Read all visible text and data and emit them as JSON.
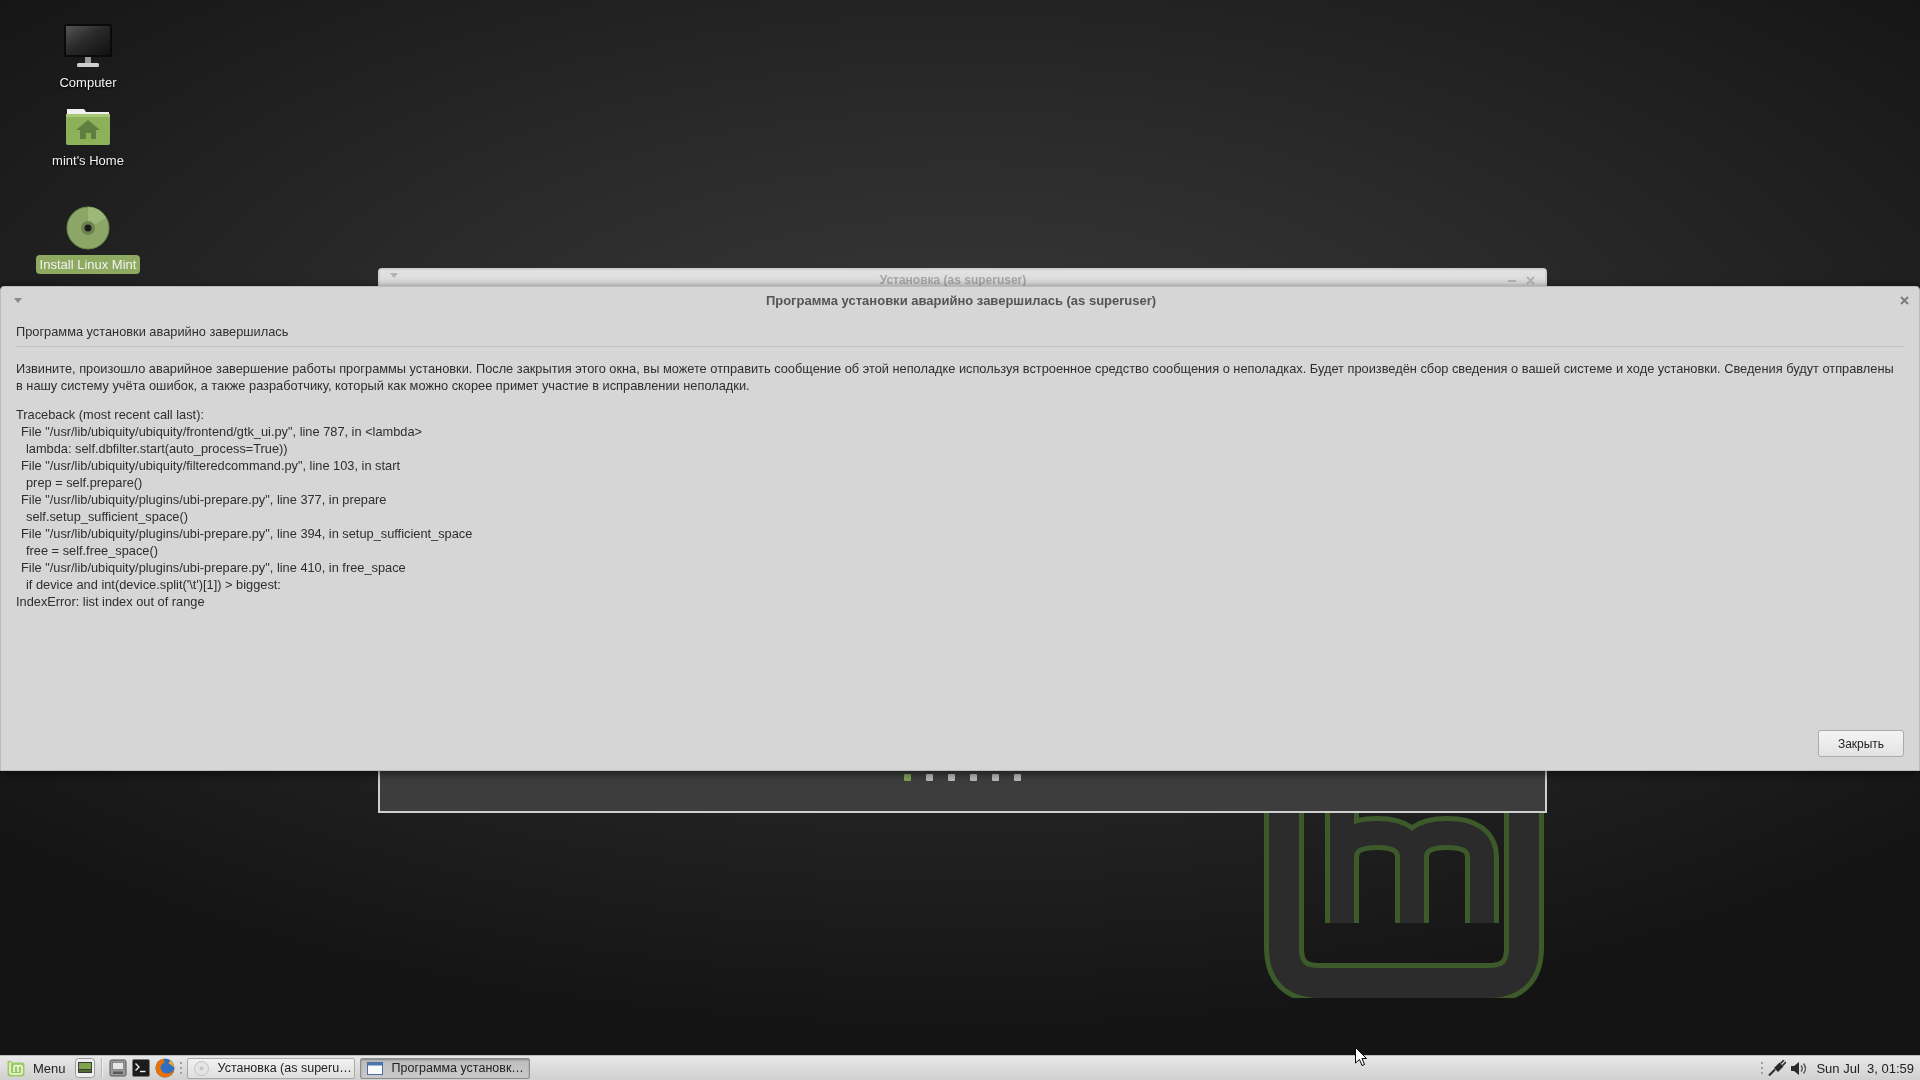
{
  "desktop": {
    "icons": [
      {
        "kind": "computer",
        "label": "Computer",
        "selected": false
      },
      {
        "kind": "home",
        "label": "mint's Home",
        "selected": false
      },
      {
        "kind": "disc",
        "label": "Install Linux Mint",
        "selected": true
      }
    ]
  },
  "background_window": {
    "title": "Установка (as superuser)",
    "slides": [
      {
        "selected": true
      },
      {
        "selected": false
      },
      {
        "selected": false
      },
      {
        "selected": false
      },
      {
        "selected": false
      },
      {
        "selected": false
      }
    ]
  },
  "dialog": {
    "title": "Программа установки аварийно завершилась (as superuser)",
    "heading": "Программа установки аварийно завершилась",
    "message": "Извините, произошло аварийное завершение работы программы установки. После закрытия этого окна, вы можете отправить сообщение об этой неполадке используя встроенное средство сообщения о неполадках. Будет произведён сбор сведения о вашей системе и ходе установки. Сведения будут отправлены в нашу систему учёта ошибок, а также разработчику, который как можно скорее примет участие в исправлении неполадки.",
    "traceback": {
      "header": "Traceback (most recent call last):",
      "frames": [
        {
          "location": "File \"/usr/lib/ubiquity/ubiquity/frontend/gtk_ui.py\", line 787, in <lambda>",
          "code": "lambda: self.dbfilter.start(auto_process=True))"
        },
        {
          "location": "File \"/usr/lib/ubiquity/ubiquity/filteredcommand.py\", line 103, in start",
          "code": "prep = self.prepare()"
        },
        {
          "location": "File \"/usr/lib/ubiquity/plugins/ubi-prepare.py\", line 377, in prepare",
          "code": "self.setup_sufficient_space()"
        },
        {
          "location": "File \"/usr/lib/ubiquity/plugins/ubi-prepare.py\", line 394, in setup_sufficient_space",
          "code": "free = self.free_space()"
        },
        {
          "location": "File \"/usr/lib/ubiquity/plugins/ubi-prepare.py\", line 410, in free_space",
          "code": "if device and int(device.split('\\t')[1]) > biggest:"
        }
      ],
      "error": "IndexError: list index out of range"
    },
    "buttons": [
      "Закрыть"
    ]
  },
  "taskbar": {
    "menu_label": "Menu",
    "launchers": [
      {
        "kind": "desktop"
      },
      {
        "kind": "files"
      },
      {
        "kind": "terminal"
      },
      {
        "kind": "browser"
      }
    ],
    "windows": [
      {
        "kind": "installer",
        "label": "Установка (as superu…",
        "selected": false
      },
      {
        "kind": "dialog",
        "label": "Программа установк…",
        "selected": true
      }
    ],
    "clock": "Sun Jul  3, 01:59"
  }
}
